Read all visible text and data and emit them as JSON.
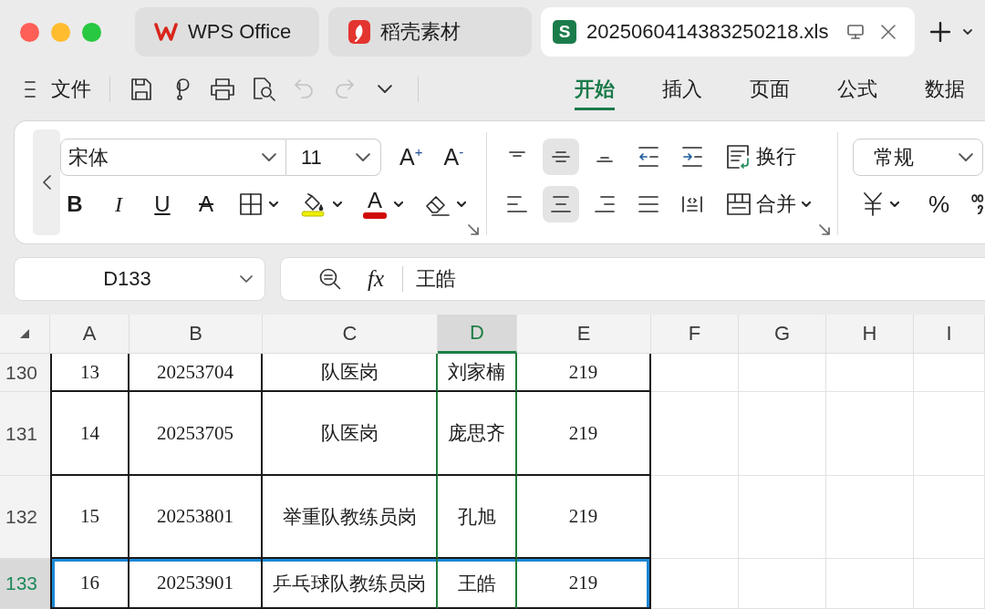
{
  "tabs": [
    {
      "kind": "app",
      "label": "WPS Office",
      "selected": false
    },
    {
      "kind": "templates",
      "label": "稻壳素材",
      "selected": false
    },
    {
      "kind": "sheet",
      "badge": "S",
      "label": "2025060414383250218.xls",
      "selected": true
    }
  ],
  "toolbar": {
    "menu_label": "文件",
    "undo": {
      "disabled": true
    },
    "redo": {
      "disabled": true
    }
  },
  "ribbon_tabs": [
    {
      "label": "开始",
      "selected": true
    },
    {
      "label": "插入",
      "selected": false
    },
    {
      "label": "页面",
      "selected": false
    },
    {
      "label": "公式",
      "selected": false
    },
    {
      "label": "数据",
      "selected": false
    }
  ],
  "font": {
    "family": "宋体",
    "size": "11",
    "grow": "A$^{+}$",
    "shrink": "A$^{-}$",
    "styles": [
      {
        "kind": "bold",
        "label": "B"
      },
      {
        "kind": "italic",
        "label": "I"
      },
      {
        "kind": "underline",
        "label": "U"
      },
      {
        "kind": "strike",
        "label": "A"
      }
    ],
    "font_color_label": "A"
  },
  "alignment": {
    "vertical": [
      {
        "selected": false
      },
      {
        "selected": true
      },
      {
        "selected": false
      }
    ],
    "horizontal": [
      {
        "selected": false
      },
      {
        "selected": true
      },
      {
        "selected": false
      },
      {
        "selected": false
      },
      {
        "selected": false
      }
    ],
    "wrap_label": "换行",
    "merge_label": "合并"
  },
  "number": {
    "format": "常规",
    "percent_label": "%"
  },
  "name_box": {
    "value": "D133"
  },
  "formula_bar": {
    "function_label": "fx",
    "value": "王皓"
  },
  "sheet": {
    "columns": [
      {
        "label": "A",
        "selected": false
      },
      {
        "label": "B",
        "selected": false
      },
      {
        "label": "C",
        "selected": false
      },
      {
        "label": "D",
        "selected": true
      },
      {
        "label": "E",
        "selected": false
      },
      {
        "label": "F",
        "selected": false
      },
      {
        "label": "G",
        "selected": false
      },
      {
        "label": "H",
        "selected": false
      },
      {
        "label": "I",
        "selected": false
      }
    ],
    "rows": [
      {
        "label": "130",
        "selected": false,
        "cells": [
          "13",
          "20253704",
          "队医岗",
          "刘家楠",
          "219"
        ]
      },
      {
        "label": "131",
        "selected": false,
        "cells": [
          "14",
          "20253705",
          "队医岗",
          "庞思齐",
          "219"
        ]
      },
      {
        "label": "132",
        "selected": false,
        "cells": [
          "15",
          "20253801",
          "举重队教练员岗",
          "孔旭",
          "219"
        ]
      },
      {
        "label": "133",
        "selected": true,
        "cells": [
          "16",
          "20253901",
          "乒乓球队教练员岗",
          "王皓",
          "219"
        ]
      }
    ]
  }
}
